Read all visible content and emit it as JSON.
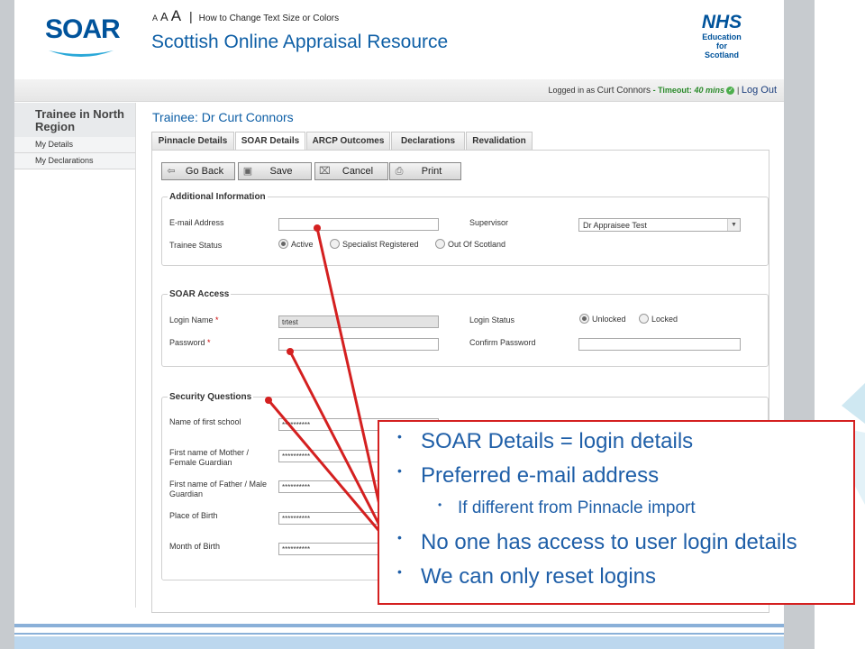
{
  "header": {
    "logo_text": "SOAR",
    "text_size": {
      "small": "A",
      "medium": "A",
      "large": "A",
      "separator": "|",
      "link": "How to Change Text Size or Colors"
    },
    "site_title": "Scottish Online Appraisal Resource",
    "partner_logo": {
      "line1": "NHS",
      "line2": "Education",
      "line3": "for",
      "line4": "Scotland"
    }
  },
  "login_bar": {
    "logged_in_as": "Logged in as",
    "user": "Curt Connors",
    "timeout_label": "- Timeout:",
    "timeout_value": "40 mins",
    "status_icon": "check-icon",
    "separator": "|",
    "logout": "Log Out"
  },
  "sidebar": {
    "heading": "Trainee in North Region",
    "items": [
      {
        "label": "My Details"
      },
      {
        "label": "My Declarations"
      }
    ]
  },
  "main": {
    "title": "Trainee: Dr Curt Connors",
    "tabs": [
      {
        "label": "Pinnacle Details"
      },
      {
        "label": "SOAR Details",
        "active": true
      },
      {
        "label": "ARCP Outcomes"
      },
      {
        "label": "Declarations"
      },
      {
        "label": "Revalidation"
      }
    ],
    "toolbar": {
      "go_back": "Go Back",
      "save": "Save",
      "cancel": "Cancel",
      "print": "Print"
    },
    "additional_info": {
      "legend": "Additional Information",
      "email_label": "E-mail Address",
      "email_value": "",
      "supervisor_label": "Supervisor",
      "supervisor_value": "Dr Appraisee Test",
      "status_label": "Trainee Status",
      "status_options": [
        {
          "label": "Active",
          "selected": true
        },
        {
          "label": "Specialist Registered",
          "selected": false
        },
        {
          "label": "Out Of Scotland",
          "selected": false
        }
      ]
    },
    "soar_access": {
      "legend": "SOAR Access",
      "login_name_label": "Login Name",
      "login_name_value": "trtest",
      "required_mark": "*",
      "login_status_label": "Login Status",
      "login_status_options": [
        {
          "label": "Unlocked",
          "selected": true
        },
        {
          "label": "Locked",
          "selected": false
        }
      ],
      "password_label": "Password",
      "password_value": "",
      "confirm_password_label": "Confirm Password",
      "confirm_password_value": ""
    },
    "security_questions": {
      "legend": "Security Questions",
      "questions": [
        {
          "label": "Name of first school",
          "value": "**********"
        },
        {
          "label": "First name of Mother / Female Guardian",
          "value": "**********"
        },
        {
          "label": "First name of Father / Male Guardian",
          "value": "**********"
        },
        {
          "label": "Place of Birth",
          "value": "**********"
        },
        {
          "label": "Month of Birth",
          "value": "**********"
        }
      ]
    }
  },
  "callout": {
    "border_color": "#d42020",
    "text_color": "#1f5fa8",
    "bullets": [
      {
        "text": "SOAR Details = login details",
        "level": 1
      },
      {
        "text": "Preferred e-mail address",
        "level": 1
      },
      {
        "text": "If different from Pinnacle import",
        "level": 2
      },
      {
        "text": "No one has access to user login details",
        "level": 1
      },
      {
        "text": "We can only reset logins",
        "level": 1
      }
    ]
  }
}
